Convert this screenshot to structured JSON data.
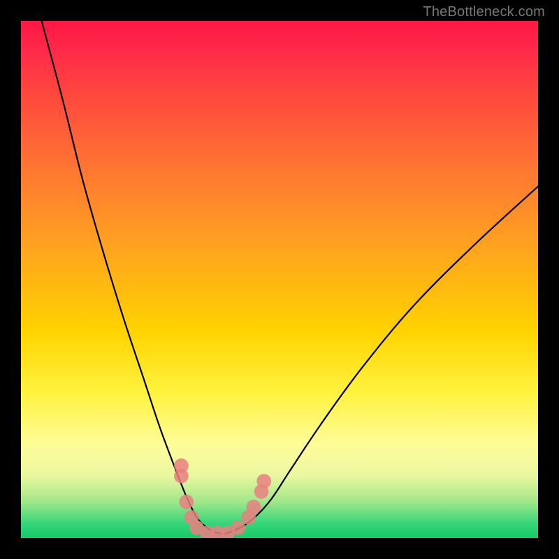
{
  "watermark": "TheBottleneck.com",
  "chart_data": {
    "type": "line",
    "title": "",
    "xlabel": "",
    "ylabel": "",
    "xlim": [
      0,
      100
    ],
    "ylim": [
      0,
      100
    ],
    "series": [
      {
        "name": "bottleneck-curve",
        "x": [
          4,
          8,
          12,
          16,
          20,
          24,
          27,
          30,
          32,
          34,
          36,
          38,
          40,
          44,
          48,
          52,
          58,
          66,
          76,
          88,
          100
        ],
        "values": [
          100,
          85,
          69,
          55,
          42,
          30,
          21,
          13,
          8,
          4,
          2,
          1,
          1,
          3,
          7,
          13,
          22,
          33,
          45,
          57,
          68
        ]
      }
    ],
    "markers": [
      {
        "x": 31,
        "y": 14,
        "r": 1.4
      },
      {
        "x": 31,
        "y": 12,
        "r": 1.4
      },
      {
        "x": 32,
        "y": 7,
        "r": 1.4
      },
      {
        "x": 33,
        "y": 4,
        "r": 1.4
      },
      {
        "x": 34,
        "y": 2,
        "r": 1.4
      },
      {
        "x": 36,
        "y": 1,
        "r": 1.4
      },
      {
        "x": 38,
        "y": 1,
        "r": 1.4
      },
      {
        "x": 40,
        "y": 1,
        "r": 1.4
      },
      {
        "x": 42,
        "y": 2,
        "r": 1.4
      },
      {
        "x": 44,
        "y": 4,
        "r": 1.4
      },
      {
        "x": 45,
        "y": 6,
        "r": 1.4
      },
      {
        "x": 46.5,
        "y": 9,
        "r": 1.4
      },
      {
        "x": 47,
        "y": 11,
        "r": 1.4
      }
    ],
    "gradient_bands": [
      {
        "pct": 0,
        "color": "#ff1744"
      },
      {
        "pct": 12,
        "color": "#ff4040"
      },
      {
        "pct": 30,
        "color": "#ff7a30"
      },
      {
        "pct": 60,
        "color": "#ffd300"
      },
      {
        "pct": 82,
        "color": "#fffc9a"
      },
      {
        "pct": 97,
        "color": "#3ad67a"
      },
      {
        "pct": 100,
        "color": "#16c96a"
      }
    ]
  }
}
